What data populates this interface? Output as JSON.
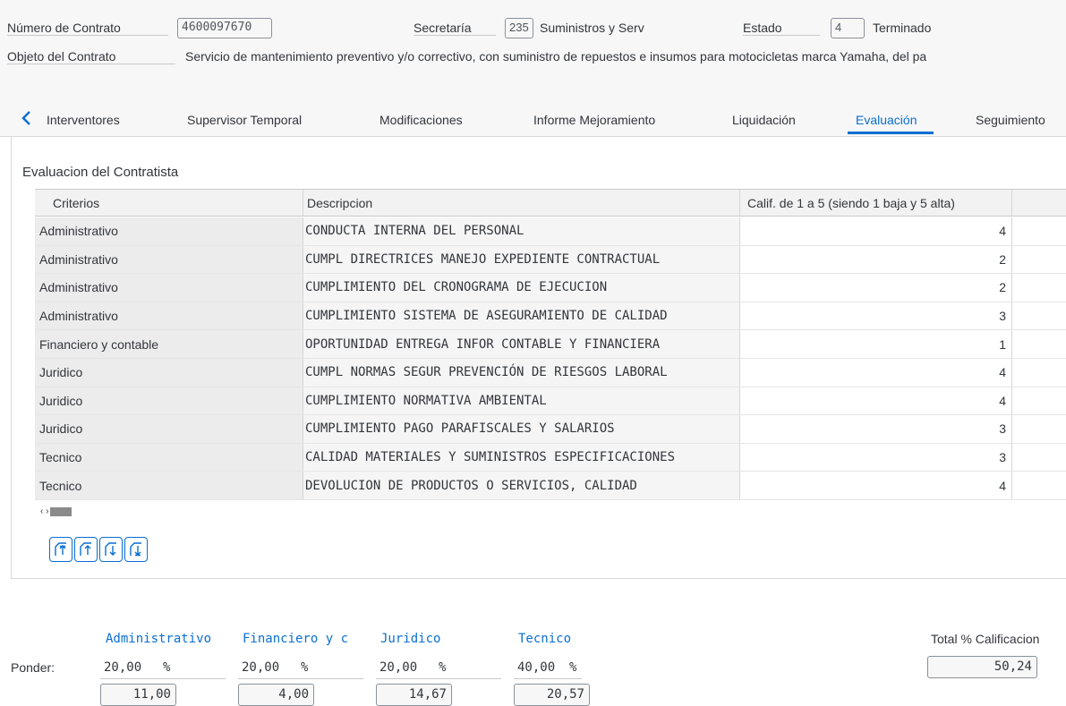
{
  "header": {
    "contract_number_label": "Número de Contrato",
    "contract_number_value": "4600097670",
    "secretaria_label": "Secretaría",
    "secretaria_code": "235",
    "secretaria_name": "Suministros y Serv",
    "estado_label": "Estado",
    "estado_code": "4",
    "estado_name": "Terminado",
    "objeto_label": "Objeto del Contrato",
    "objeto_text": "Servicio de mantenimiento preventivo y/o correctivo, con suministro de repuestos e insumos para motocicletas marca Yamaha, del pa"
  },
  "tabs": [
    "Interventores",
    "Supervisor Temporal",
    "Modificaciones",
    "Informe Mejoramiento",
    "Liquidación",
    "Evaluación",
    "Seguimiento"
  ],
  "active_tab": "Evaluación",
  "section_title": "Evaluacion del Contratista",
  "table": {
    "columns": [
      "Criterios",
      "Descripcion",
      "Calif. de 1 a 5 (siendo 1 baja y 5 alta)"
    ],
    "rows": [
      {
        "criterio": "Administrativo",
        "descripcion": "CONDUCTA INTERNA DEL PERSONAL",
        "calif": "4"
      },
      {
        "criterio": "Administrativo",
        "descripcion": "CUMPL DIRECTRICES MANEJO EXPEDIENTE CONTRACTUAL",
        "calif": "2"
      },
      {
        "criterio": "Administrativo",
        "descripcion": "CUMPLIMIENTO DEL CRONOGRAMA DE EJECUCION",
        "calif": "2"
      },
      {
        "criterio": "Administrativo",
        "descripcion": "CUMPLIMIENTO SISTEMA DE ASEGURAMIENTO DE CALIDAD",
        "calif": "3"
      },
      {
        "criterio": "Financiero y contable",
        "descripcion": "OPORTUNIDAD ENTREGA INFOR CONTABLE Y FINANCIERA",
        "calif": "1"
      },
      {
        "criterio": "Juridico",
        "descripcion": "CUMPL NORMAS SEGUR PREVENCIÓN DE RIESGOS LABORAL",
        "calif": "4"
      },
      {
        "criterio": "Juridico",
        "descripcion": "CUMPLIMIENTO NORMATIVA AMBIENTAL",
        "calif": "4"
      },
      {
        "criterio": "Juridico",
        "descripcion": "CUMPLIMIENTO PAGO PARAFISCALES Y SALARIOS",
        "calif": "3"
      },
      {
        "criterio": "Tecnico",
        "descripcion": "CALIDAD MATERIALES Y SUMINISTROS ESPECIFICACIONES",
        "calif": "3"
      },
      {
        "criterio": "Tecnico",
        "descripcion": "DEVOLUCION DE PRODUCTOS O SERVICIOS, CALIDAD",
        "calif": "4"
      }
    ]
  },
  "scroll_arrows": "‹ ›",
  "toolbar_icons": [
    "scroll-to-top-icon",
    "page-up-icon",
    "page-down-icon",
    "scroll-to-bottom-icon"
  ],
  "weights": {
    "ponder_label": "Ponder:",
    "percent_sign": "%",
    "categories": [
      {
        "name": "Administrativo",
        "ponder": "20,00",
        "result": "11,00"
      },
      {
        "name": "Financiero y c",
        "ponder": "20,00",
        "result": "4,00"
      },
      {
        "name": "Juridico",
        "ponder": "20,00",
        "result": "14,67"
      },
      {
        "name": "Tecnico",
        "ponder": "40,00",
        "result": "20,57"
      }
    ],
    "total_label": "Total % Calificacion",
    "total_value": "50,24"
  },
  "colors": {
    "accent": "#0a6ed1",
    "header_bg": "#f7f7f7",
    "text": "#32363a"
  }
}
